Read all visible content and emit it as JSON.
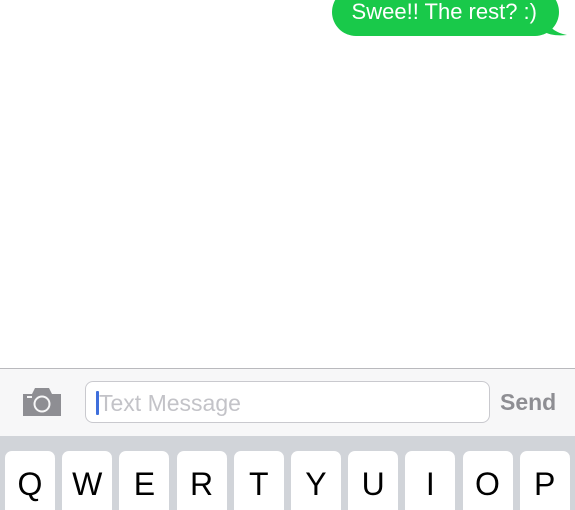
{
  "conversation": {
    "messages": [
      {
        "direction": "outgoing",
        "text": "Swee!! The rest? :)"
      }
    ]
  },
  "input_bar": {
    "camera_icon": "camera-icon",
    "placeholder": "Text Message",
    "send_label": "Send"
  },
  "keyboard": {
    "rows": [
      [
        "Q",
        "W",
        "E",
        "R",
        "T",
        "Y",
        "U",
        "I",
        "O",
        "P"
      ]
    ]
  },
  "colors": {
    "bubble_green": "#19c94a",
    "caret_blue": "#3f6fdc",
    "send_disabled_gray": "#8e8e93",
    "keyboard_background": "#d1d4d9"
  }
}
